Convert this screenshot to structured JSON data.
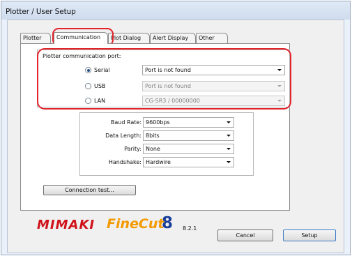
{
  "window": {
    "title": "Plotter / User Setup"
  },
  "tabs": [
    {
      "label": "Plotter",
      "active": false
    },
    {
      "label": "Communication",
      "active": true
    },
    {
      "label": "Plot Dialog",
      "active": false
    },
    {
      "label": "Alert Display",
      "active": false
    },
    {
      "label": "Other",
      "active": false
    }
  ],
  "port_group": {
    "title": "Plotter communication port:",
    "options": [
      {
        "label": "Serial",
        "selected": true,
        "value": "Port is not found",
        "enabled": true
      },
      {
        "label": "USB",
        "selected": false,
        "value": "Port is not found",
        "enabled": false
      },
      {
        "label": "LAN",
        "selected": false,
        "value": "CG-SR3 / 00000000",
        "enabled": false
      }
    ]
  },
  "serial_settings": [
    {
      "label": "Baud Rate:",
      "value": "9600bps"
    },
    {
      "label": "Data Length:",
      "value": "8bits"
    },
    {
      "label": "Parity:",
      "value": "None"
    },
    {
      "label": "Handshake:",
      "value": "Hardwire"
    }
  ],
  "buttons": {
    "connection_test": "Connection test...",
    "cancel": "Cancel",
    "setup": "Setup"
  },
  "brand": {
    "maker": "MIMAKI",
    "product": "FineCut",
    "product_number": "8",
    "version": "8.2.1"
  },
  "colors": {
    "highlight": "#e2232a",
    "maker_red": "#d0131a",
    "product_orange": "#f39a00",
    "product_blue": "#1b3f99"
  }
}
